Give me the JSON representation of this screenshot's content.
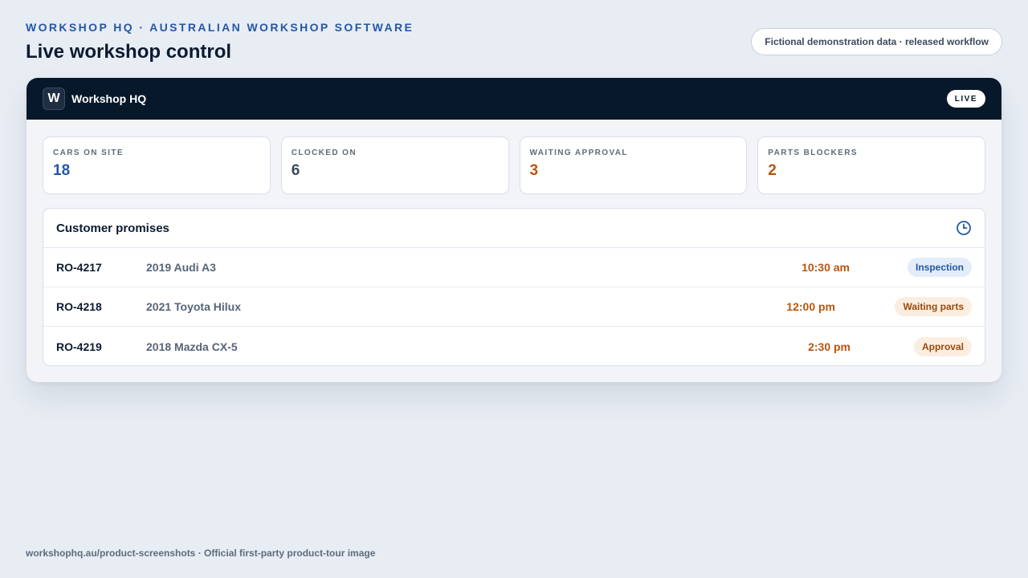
{
  "header": {
    "eyebrow": "WORKSHOP HQ · AUSTRALIAN WORKSHOP SOFTWARE",
    "title": "Live workshop control",
    "note": "Fictional demonstration data · released workflow"
  },
  "app": {
    "logo_letter": "W",
    "name": "Workshop HQ",
    "badge": "LIVE"
  },
  "stats": [
    {
      "label": "CARS ON SITE",
      "value": "18",
      "color": "#2457a6"
    },
    {
      "label": "CLOCKED ON",
      "value": "6",
      "color": "#3c4a5c"
    },
    {
      "label": "WAITING APPROVAL",
      "value": "3",
      "color": "#b8560f"
    },
    {
      "label": "PARTS BLOCKERS",
      "value": "2",
      "color": "#b8560f"
    }
  ],
  "promises": {
    "title": "Customer promises",
    "icon": "clock-icon",
    "rows": [
      {
        "ro": "RO-4217",
        "vehicle": "2019 Audi A3",
        "time": "10:30 am",
        "status": "Inspection"
      },
      {
        "ro": "RO-4218",
        "vehicle": "2021 Toyota Hilux",
        "time": "12:00 pm",
        "status": "Waiting parts"
      },
      {
        "ro": "RO-4219",
        "vehicle": "2018 Mazda CX-5",
        "time": "2:30 pm",
        "status": "Approval"
      }
    ]
  },
  "footer": "workshophq.au/product-screenshots · Official first-party product-tour image",
  "colors": {
    "accent": "#2457a6",
    "warning": "#b8560f",
    "app_bar": "#08182b"
  }
}
